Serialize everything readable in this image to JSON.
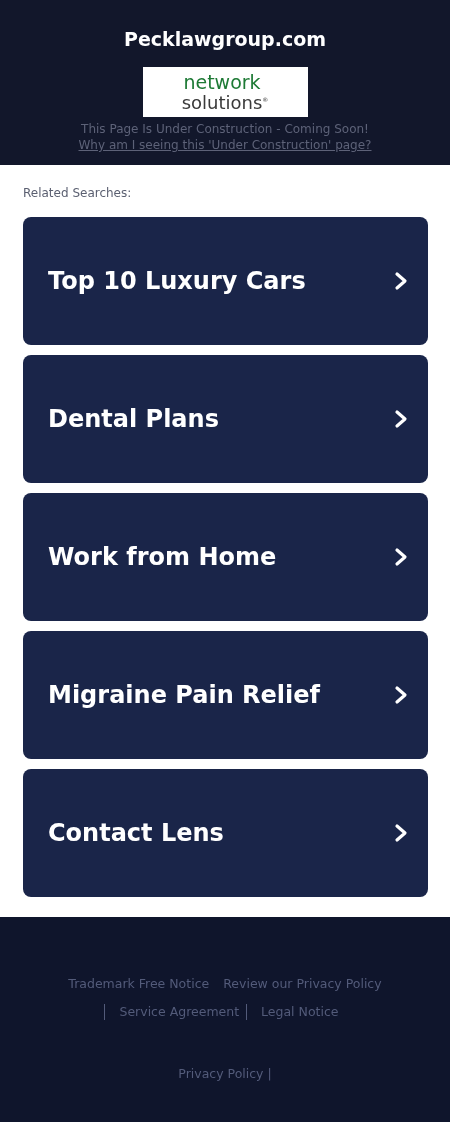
{
  "header": {
    "title": "Pecklawgroup.com",
    "logo": {
      "lines": [
        "network",
        "solutions$^{®}$"
      ]
    },
    "notice": "This Page Is Under Construction - Coming Soon!",
    "why_link": "Why am I seeing this 'Under Construction' page?"
  },
  "related": {
    "heading": "Related Searches:",
    "items": [
      {
        "label": "Top 10 Luxury Cars"
      },
      {
        "label": "Dental Plans"
      },
      {
        "label": "Work from Home"
      },
      {
        "label": "Migraine Pain Relief"
      },
      {
        "label": "Contact Lens"
      }
    ]
  },
  "footer": {
    "links": [
      {
        "label": "Trademark Free Notice",
        "divider_before": false
      },
      {
        "label": "Review our Privacy Policy",
        "divider_before": false
      },
      {
        "label": "Service Agreement",
        "divider_before": true
      },
      {
        "label": "Legal Notice",
        "divider_before": true
      }
    ],
    "bottom_link": "Privacy Policy |"
  }
}
